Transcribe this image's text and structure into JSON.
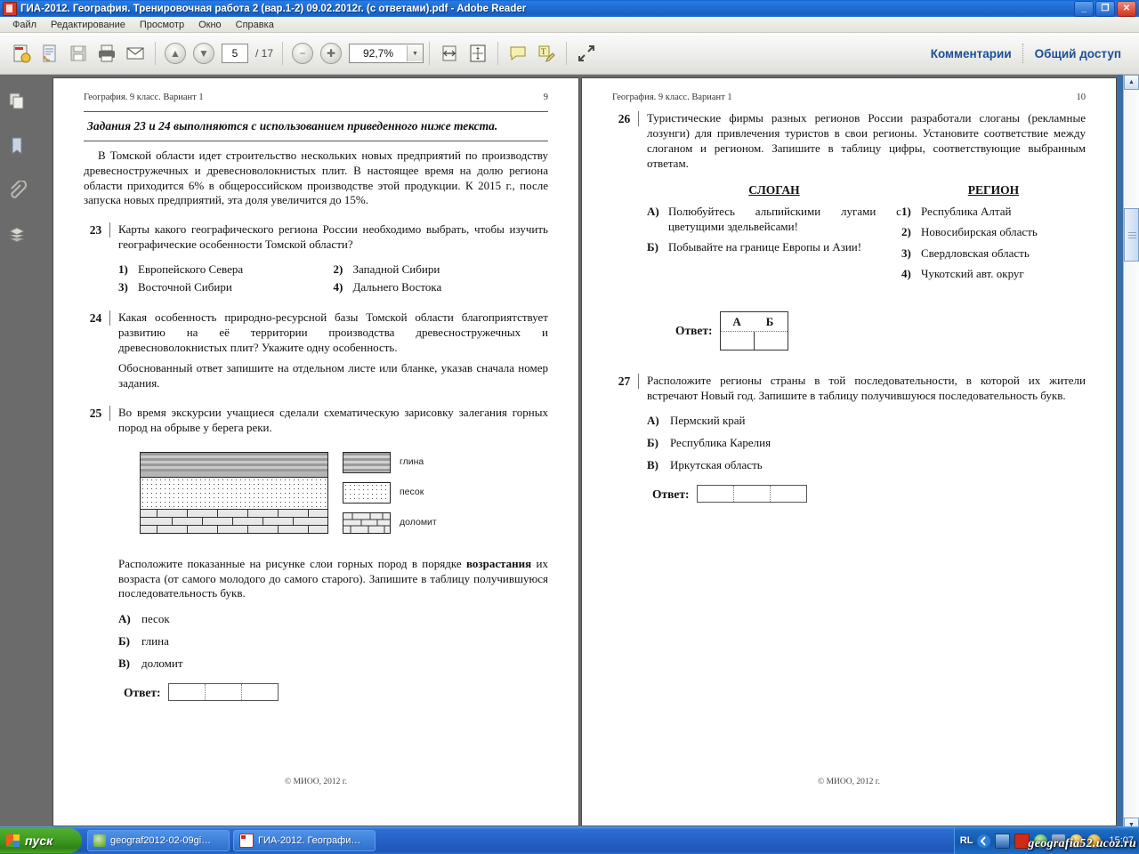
{
  "window": {
    "title": "ГИА-2012. География. Тренировочная работа 2 (вар.1-2) 09.02.2012г. (с ответами).pdf - Adobe Reader",
    "minimize": "_",
    "maximize": "❐",
    "close": "✕"
  },
  "menu": {
    "items": [
      "Файл",
      "Редактирование",
      "Просмотр",
      "Окно",
      "Справка"
    ]
  },
  "toolbar": {
    "page_current": "5",
    "page_total": "/ 17",
    "zoom_value": "92,7%",
    "zoom_arrow": "▼",
    "prev_glyph": "▲",
    "next_glyph": "▼",
    "minus_glyph": "−",
    "plus_glyph": "✚",
    "comments_label": "Комментарии",
    "share_label": "Общий доступ"
  },
  "left_page": {
    "header_left": "География. 9 класс. Вариант 1",
    "header_right": "9",
    "lead": "Задания 23 и 24 выполняются с использованием приведенного ниже текста.",
    "intro": "В Томской области идет строительство нескольких новых предприятий по производству древесностружечных и древесноволокнистых плит. В настоящее время на долю региона области приходится 6% в общероссийском производстве этой продукции. К 2015 г., после запуска новых предприятий, эта доля увеличится до 15%.",
    "q23": {
      "number": "23",
      "text": "Карты какого географического региона России необходимо выбрать, чтобы изучить географические особенности Томской области?",
      "options": [
        {
          "marker": "1)",
          "label": "Европейского Севера"
        },
        {
          "marker": "2)",
          "label": "Западной Сибири"
        },
        {
          "marker": "3)",
          "label": "Восточной Сибири"
        },
        {
          "marker": "4)",
          "label": "Дальнего Востока"
        }
      ]
    },
    "q24": {
      "number": "24",
      "text": "Какая особенность природно-ресурсной базы Томской области благоприятствует развитию на её территории производства древесностружечных и древесноволокнистых плит? Укажите одну особенность.",
      "note": "Обоснованный ответ запишите на отдельном листе или бланке, указав сначала номер задания."
    },
    "q25": {
      "number": "25",
      "text": "Во время экскурсии учащиеся сделали схематическую зарисовку залегания горных пород на обрыве у берега реки.",
      "legend": [
        {
          "name": "clay-swatch",
          "label": "глина"
        },
        {
          "name": "sand-swatch",
          "label": "песок"
        },
        {
          "name": "dolomite-swatch",
          "label": "доломит"
        }
      ],
      "prompt_a": "Расположите показанные на рисунке слои горных пород в порядке ",
      "prompt_bold": "возрастания",
      "prompt_b": " их возраста (от самого молодого до самого старого). Запишите в таблицу получившуюся последовательность букв.",
      "options": [
        {
          "marker": "А)",
          "label": "песок"
        },
        {
          "marker": "Б)",
          "label": "глина"
        },
        {
          "marker": "В)",
          "label": "доломит"
        }
      ],
      "answer_label": "Ответ:"
    },
    "footer": "© МИОО, 2012 г."
  },
  "right_page": {
    "header_left": "География. 9 класс. Вариант 1",
    "header_right": "10",
    "q26": {
      "number": "26",
      "text": "Туристические фирмы разных регионов России разработали слоганы (рекламные лозунги) для привлечения туристов в свои регионы. Установите соответствие между слоганом и регионом. Запишите в таблицу цифры, соответствующие выбранным ответам.",
      "head_left": "СЛОГАН",
      "head_right": "РЕГИОН",
      "slogans": [
        {
          "marker": "А)",
          "label": "Полюбуйтесь альпийскими лугами с цветущими эдельвейсами!"
        },
        {
          "marker": "Б)",
          "label": "Побывайте на границе Европы и Азии!"
        }
      ],
      "regions": [
        {
          "marker": "1)",
          "label": "Республика Алтай"
        },
        {
          "marker": "2)",
          "label": "Новосибирская область"
        },
        {
          "marker": "3)",
          "label": "Свердловская область"
        },
        {
          "marker": "4)",
          "label": "Чукотский авт. округ"
        }
      ],
      "answer_label": "Ответ:",
      "answer_headers": [
        "А",
        "Б"
      ]
    },
    "q27": {
      "number": "27",
      "text": "Расположите регионы страны в той последовательности, в которой их жители встречают Новый год. Запишите в таблицу получившуюся последовательность букв.",
      "options": [
        {
          "marker": "А)",
          "label": "Пермский край"
        },
        {
          "marker": "Б)",
          "label": "Республика Карелия"
        },
        {
          "marker": "В)",
          "label": "Иркутская область"
        }
      ],
      "answer_label": "Ответ:"
    },
    "footer": "© МИОО, 2012 г."
  },
  "taskbar": {
    "start_label": "пуск",
    "buttons": [
      {
        "label": "geograf2012-02-09gi…",
        "icon": "browser-icon"
      },
      {
        "label": "ГИА-2012. Географи…",
        "icon": "pdf-icon"
      }
    ],
    "lang": "RL",
    "clock": "15:07",
    "watermark": "geografia52.ucoz.ru"
  }
}
